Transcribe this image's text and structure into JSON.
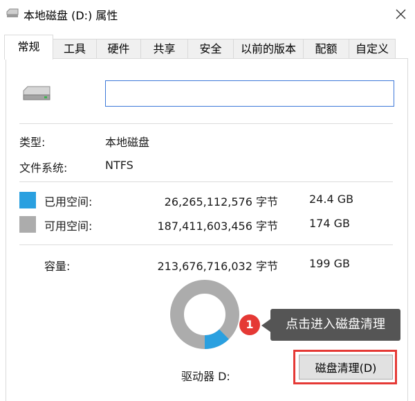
{
  "window": {
    "title": "本地磁盘 (D:) 属性",
    "close_glyph": "✕"
  },
  "tabs": [
    {
      "label": "常规",
      "active": true
    },
    {
      "label": "工具"
    },
    {
      "label": "硬件"
    },
    {
      "label": "共享"
    },
    {
      "label": "安全"
    },
    {
      "label": "以前的版本"
    },
    {
      "label": "配额"
    },
    {
      "label": "自定义"
    }
  ],
  "general": {
    "volume_name_value": "",
    "type_label": "类型:",
    "type_value": "本地磁盘",
    "fs_label": "文件系统:",
    "fs_value": "NTFS",
    "used_label": "已用空间:",
    "used_bytes": "26,265,112,576 字节",
    "used_size": "24.4 GB",
    "free_label": "可用空间:",
    "free_bytes": "187,411,603,456 字节",
    "free_size": "174 GB",
    "capacity_label": "容量:",
    "capacity_bytes": "213,676,716,032 字节",
    "capacity_size": "199 GB",
    "drive_label": "驱动器 D:",
    "cleanup_button": "磁盘清理(D)",
    "used_fraction": 0.123
  },
  "callout": {
    "number": "1",
    "text": "点击进入磁盘清理"
  },
  "colors": {
    "used": "#2aa0e0",
    "free": "#acacac",
    "accent": "#3c78d8",
    "highlight": "#e53935"
  }
}
